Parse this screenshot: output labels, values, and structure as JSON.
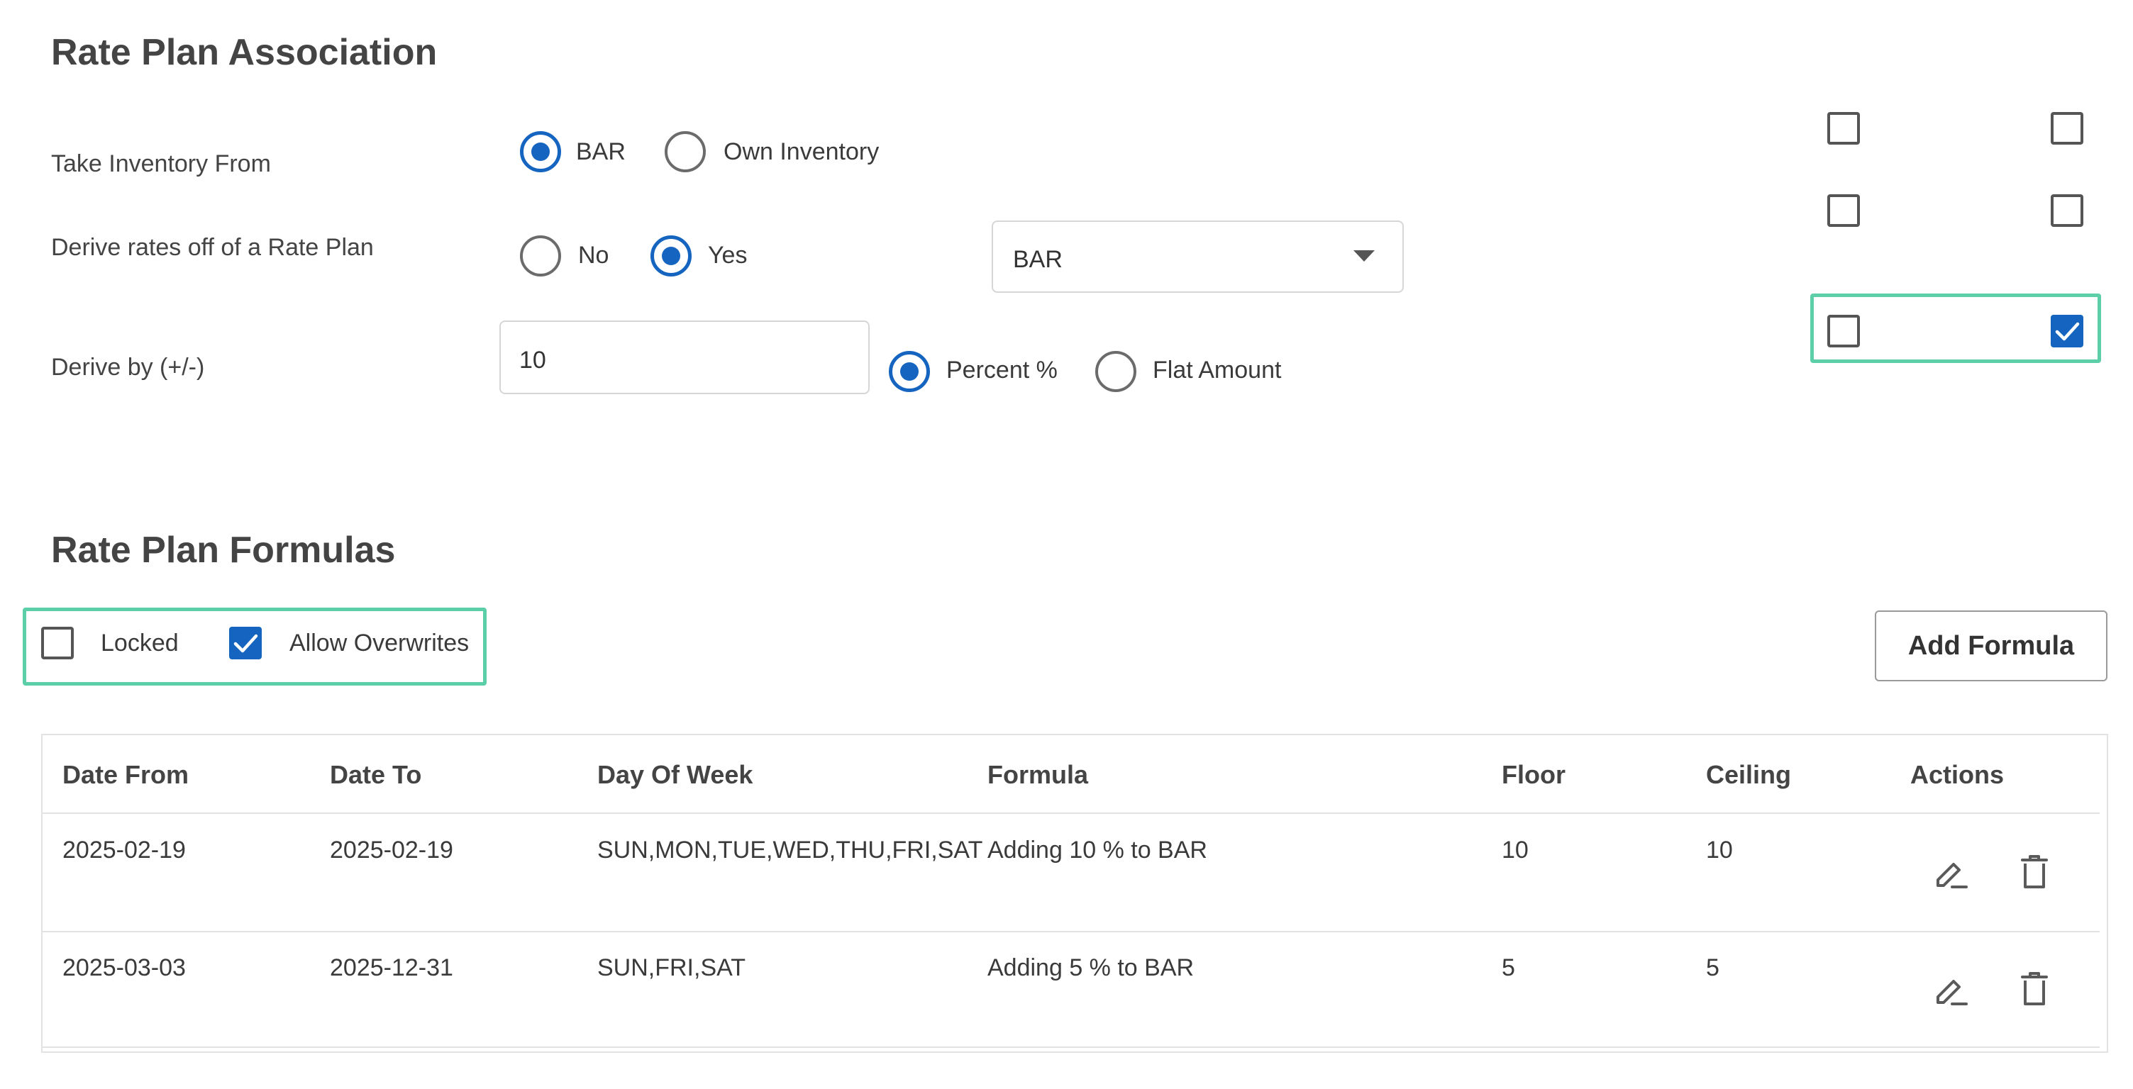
{
  "association": {
    "title": "Rate Plan Association",
    "take_inventory": {
      "label": "Take Inventory From",
      "options": [
        "BAR",
        "Own Inventory"
      ],
      "selected": "BAR"
    },
    "derive_rates": {
      "label": "Derive rates off of a Rate Plan",
      "options": [
        "No",
        "Yes"
      ],
      "selected": "Yes",
      "select_value": "BAR"
    },
    "derive_by": {
      "label": "Derive by (+/-)",
      "value": "10",
      "options": [
        "Percent %",
        "Flat Amount"
      ],
      "selected": "Percent %"
    },
    "side_checkboxes": [
      {
        "left": false,
        "right": false
      },
      {
        "left": false,
        "right": false
      },
      {
        "left": false,
        "right": true
      }
    ]
  },
  "formulas": {
    "title": "Rate Plan Formulas",
    "locked_label": "Locked",
    "locked": false,
    "allow_overwrites_label": "Allow Overwrites",
    "allow_overwrites": true,
    "add_button": "Add Formula",
    "columns": [
      "Date From",
      "Date To",
      "Day Of Week",
      "Formula",
      "Floor",
      "Ceiling",
      "Actions"
    ],
    "rows": [
      {
        "date_from": "2025-02-19",
        "date_to": "2025-02-19",
        "days": "SUN,MON,TUE,WED,THU,FRI,SAT",
        "formula": "Adding 10 % to BAR",
        "floor": "10",
        "ceiling": "10"
      },
      {
        "date_from": "2025-03-03",
        "date_to": "2025-12-31",
        "days": "SUN,FRI,SAT",
        "formula": "Adding 5 % to BAR",
        "floor": "5",
        "ceiling": "5"
      }
    ]
  },
  "icons": {
    "edit": "pencil-edit-icon",
    "delete": "trash-icon",
    "dropdown": "caret-down-icon",
    "check": "checkmark-icon"
  },
  "colors": {
    "accent": "#1565c0",
    "highlight": "#5ccfa8",
    "text": "#444444"
  }
}
